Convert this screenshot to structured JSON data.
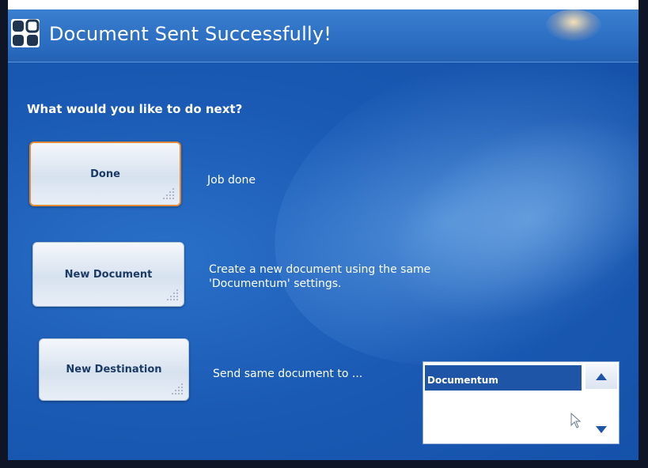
{
  "window": {
    "title": "Document Sent Successfully!",
    "icon": "app-logo-icon"
  },
  "main": {
    "question": "What would you like to do next?",
    "actions": [
      {
        "label": "Done",
        "description": "Job done"
      },
      {
        "label": "New Document",
        "description": "Create a new document using the same 'Documentum' settings."
      },
      {
        "label": "New Destination",
        "description": "Send same document to ..."
      }
    ]
  },
  "destination_list": {
    "items": [
      "Documentum"
    ],
    "selected": "Documentum",
    "scroll_up_icon": "triangle-up-icon",
    "scroll_down_icon": "triangle-down-icon"
  },
  "colors": {
    "background": "#1a5ab4",
    "title_bar": "#2a6cc0",
    "selection": "#1f55a6",
    "done_border": "#e08a3a",
    "button_text": "#1c3a66"
  }
}
